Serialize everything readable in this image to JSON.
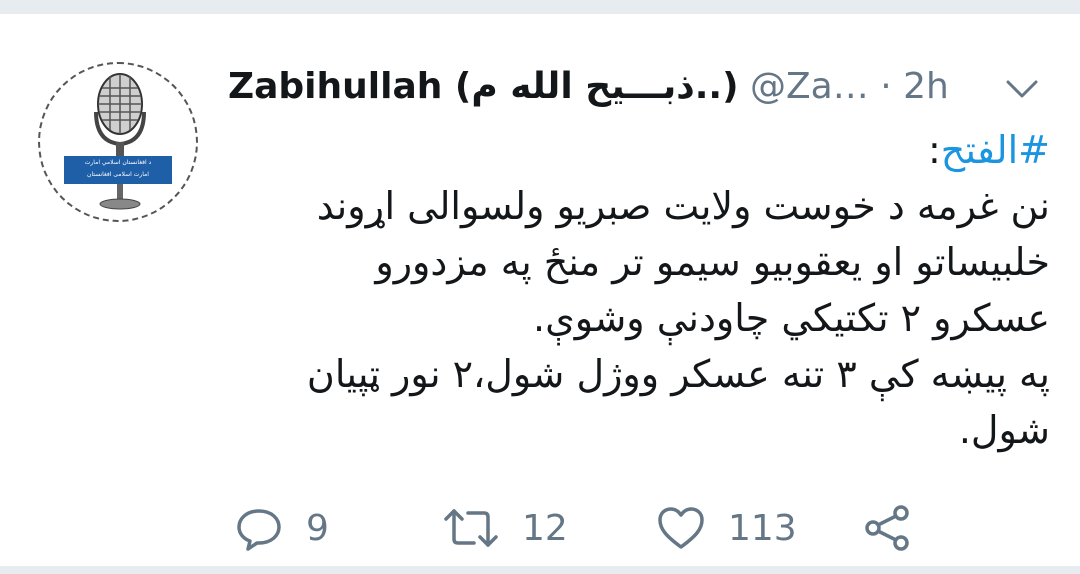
{
  "tweet": {
    "author": {
      "display_name": "Zabihullah (ذبـــیح الله م..)",
      "handle": "@Za…",
      "separator": "·",
      "time": "2h",
      "avatar_icon": "microphone-icon",
      "avatar_banner_text_1": "د افغانستان اسلامي امارت",
      "avatar_banner_text_2": "امارت اسلامی افغانستان"
    },
    "more_icon": "chevron-down-icon",
    "body": {
      "hashtag": "#الفتح",
      "hashtag_suffix": ":",
      "line_1": "نن غرمه د خوست ولايت صبريو ولسوالی اړوند خلبيساتو او يعقوبيو سيمو تر منځ په مزدورو عسکرو ۲ تکتيکي چاودنې وشوې.",
      "line_2": "په پيښه کې ۳ تنه عسکر ووژل شول،۲ نور ټپيان شول."
    },
    "actions": {
      "reply_count": "9",
      "retweet_count": "12",
      "like_count": "113",
      "reply_icon": "reply-icon",
      "retweet_icon": "retweet-icon",
      "like_icon": "heart-icon",
      "share_icon": "share-icon"
    }
  },
  "colors": {
    "text": "#14171a",
    "muted": "#657786",
    "link": "#1b95e0",
    "divider": "#e6ecf0",
    "banner": "#1f5fa8"
  }
}
